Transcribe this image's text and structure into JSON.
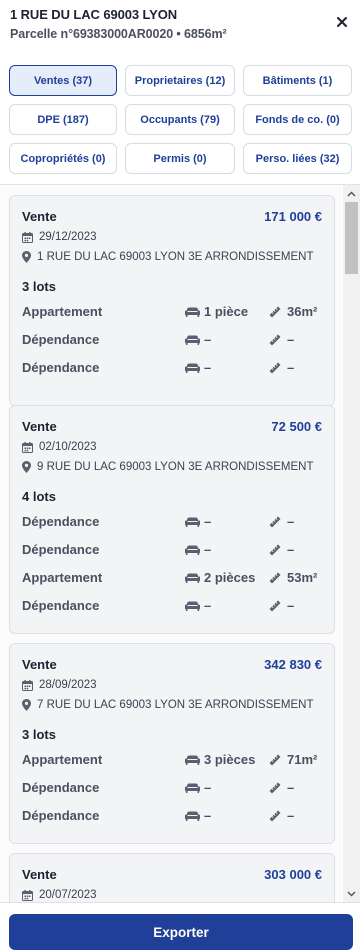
{
  "header": {
    "address": "1 RUE DU LAC 69003 LYON",
    "parcel": "Parcelle n°69383000AR0020 • 6856m²"
  },
  "tabs": [
    {
      "label": "Ventes (37)",
      "active": true
    },
    {
      "label": "Proprietaires (12)",
      "active": false
    },
    {
      "label": "Bâtiments (1)",
      "active": false
    },
    {
      "label": "DPE (187)",
      "active": false
    },
    {
      "label": "Occupants (79)",
      "active": false
    },
    {
      "label": "Fonds de co. (0)",
      "active": false
    },
    {
      "label": "Copropriétés (0)",
      "active": false
    },
    {
      "label": "Permis (0)",
      "active": false
    },
    {
      "label": "Perso. liées (32)",
      "active": false
    }
  ],
  "sales": [
    {
      "title": "Vente",
      "price": "171 000 €",
      "date": "29/12/2023",
      "address": "1 RUE DU LAC 69003 LYON 3E ARRONDISSEMENT",
      "lots_label": "3 lots",
      "lots": [
        {
          "type": "Appartement",
          "rooms": "1 pièce",
          "area": "36m²"
        },
        {
          "type": "Dépendance",
          "rooms": "–",
          "area": "–"
        },
        {
          "type": "Dépendance",
          "rooms": "–",
          "area": "–"
        }
      ]
    },
    {
      "title": "Vente",
      "price": "72 500 €",
      "date": "02/10/2023",
      "address": "9 RUE DU LAC 69003 LYON 3E ARRONDISSEMENT",
      "lots_label": "4 lots",
      "lots": [
        {
          "type": "Dépendance",
          "rooms": "–",
          "area": "–"
        },
        {
          "type": "Dépendance",
          "rooms": "–",
          "area": "–"
        },
        {
          "type": "Appartement",
          "rooms": "2 pièces",
          "area": "53m²"
        },
        {
          "type": "Dépendance",
          "rooms": "–",
          "area": "–"
        }
      ]
    },
    {
      "title": "Vente",
      "price": "342 830 €",
      "date": "28/09/2023",
      "address": "7 RUE DU LAC 69003 LYON 3E ARRONDISSEMENT",
      "lots_label": "3 lots",
      "lots": [
        {
          "type": "Appartement",
          "rooms": "3 pièces",
          "area": "71m²"
        },
        {
          "type": "Dépendance",
          "rooms": "–",
          "area": "–"
        },
        {
          "type": "Dépendance",
          "rooms": "–",
          "area": "–"
        }
      ]
    },
    {
      "title": "Vente",
      "price": "303 000 €",
      "date": "20/07/2023",
      "address": "",
      "lots_label": "",
      "lots": []
    }
  ],
  "footer": {
    "export_label": "Exporter"
  },
  "colors": {
    "accent": "#1f3f99",
    "active_tab_bg": "#e5ecfa"
  },
  "icons": {
    "close": "close-icon",
    "date": "calendar-icon",
    "address": "map-pin-icon",
    "rooms": "sofa-icon",
    "area": "ruler-icon"
  }
}
